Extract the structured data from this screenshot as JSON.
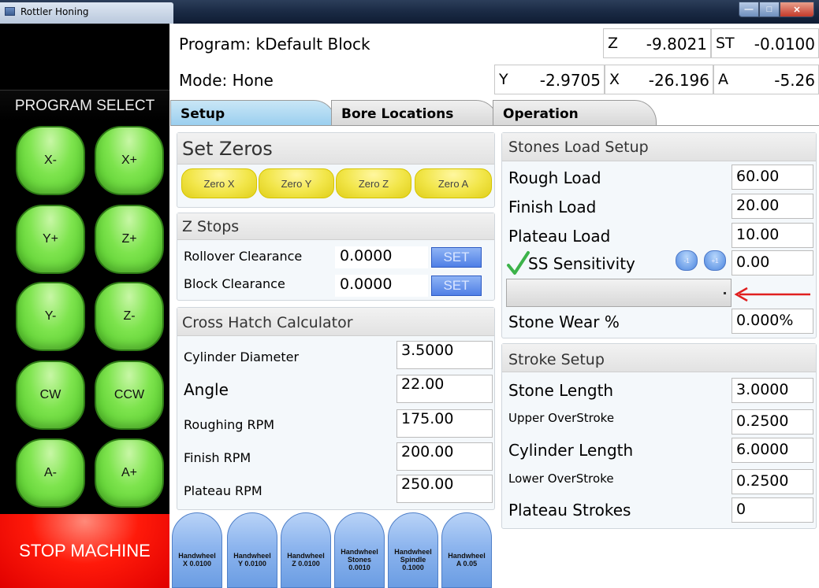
{
  "window": {
    "title": "Rottler Honing",
    "minimize_glyph": "—",
    "maximize_glyph": "□",
    "close_glyph": "✕"
  },
  "left": {
    "program_select": "PROGRAM SELECT",
    "jog": [
      "X-",
      "X+",
      "Y+",
      "Z+",
      "Y-",
      "Z-",
      "CW",
      "CCW",
      "A-",
      "A+"
    ],
    "stop": "STOP MACHINE"
  },
  "header": {
    "program": "Program: kDefault Block",
    "mode": "Mode: Hone",
    "axes": {
      "z": {
        "label": "Z",
        "value": "-9.8021"
      },
      "st": {
        "label": "ST",
        "value": "-0.0100"
      },
      "y": {
        "label": "Y",
        "value": "-2.9705"
      },
      "x": {
        "label": "X",
        "value": "-26.196"
      },
      "a": {
        "label": "A",
        "value": "-5.26"
      }
    }
  },
  "tabs": [
    "Setup",
    "Bore Locations",
    "Operation"
  ],
  "set_zeros": {
    "title": "Set Zeros",
    "buttons": [
      "Zero X",
      "Zero Y",
      "Zero Z",
      "Zero A"
    ]
  },
  "z_stops": {
    "title": "Z Stops",
    "rows": [
      {
        "label": "Rollover Clearance",
        "value": "0.0000",
        "button": "SET"
      },
      {
        "label": "Block Clearance",
        "value": "0.0000",
        "button": "SET"
      }
    ]
  },
  "cross_hatch": {
    "title": "Cross Hatch Calculator",
    "rows": [
      {
        "label": "Cylinder Diameter",
        "value": "3.5000"
      },
      {
        "label": "Angle",
        "value": "22.00"
      },
      {
        "label": "Roughing RPM",
        "value": "175.00"
      },
      {
        "label": "Finish RPM",
        "value": "200.00"
      },
      {
        "label": "Plateau RPM",
        "value": "250.00"
      }
    ]
  },
  "handwheels": [
    [
      "Handwheel",
      "X 0.0100"
    ],
    [
      "Handwheel",
      "Y 0.0100"
    ],
    [
      "Handwheel",
      "Z 0.0100"
    ],
    [
      "Handwheel",
      "Stones",
      "0.0010"
    ],
    [
      "Handwheel",
      "Spindle",
      "0.1000"
    ],
    [
      "Handwheel",
      "A 0.05"
    ]
  ],
  "stones_load": {
    "title": "Stones Load Setup",
    "rough_label": "Rough Load",
    "rough_value": "60.00",
    "finish_label": "Finish Load",
    "finish_value": "20.00",
    "plateau_label": "Plateau Load",
    "plateau_value": "10.00",
    "ss_label": "SS Sensitivity",
    "ss_value": "0.00",
    "ss_minus": "-1",
    "ss_plus": "+1",
    "wear_label": "Stone Wear %",
    "wear_value": "0.000%"
  },
  "stroke": {
    "title": "Stroke Setup",
    "rows": [
      {
        "label": "Stone Length",
        "value": "3.0000"
      },
      {
        "label": "Upper OverStroke",
        "value": "0.2500"
      },
      {
        "label": "Cylinder Length",
        "value": "6.0000"
      },
      {
        "label": "Lower OverStroke",
        "value": "0.2500"
      },
      {
        "label": "Plateau Strokes",
        "value": "0"
      }
    ]
  },
  "colors": {
    "jog_green": "#7ee44e",
    "stop_red": "#ff1a0a",
    "zero_yellow": "#f2e64a",
    "set_blue": "#4f7fe6",
    "arrow_red": "#e02020",
    "check_green": "#3cb34a"
  }
}
